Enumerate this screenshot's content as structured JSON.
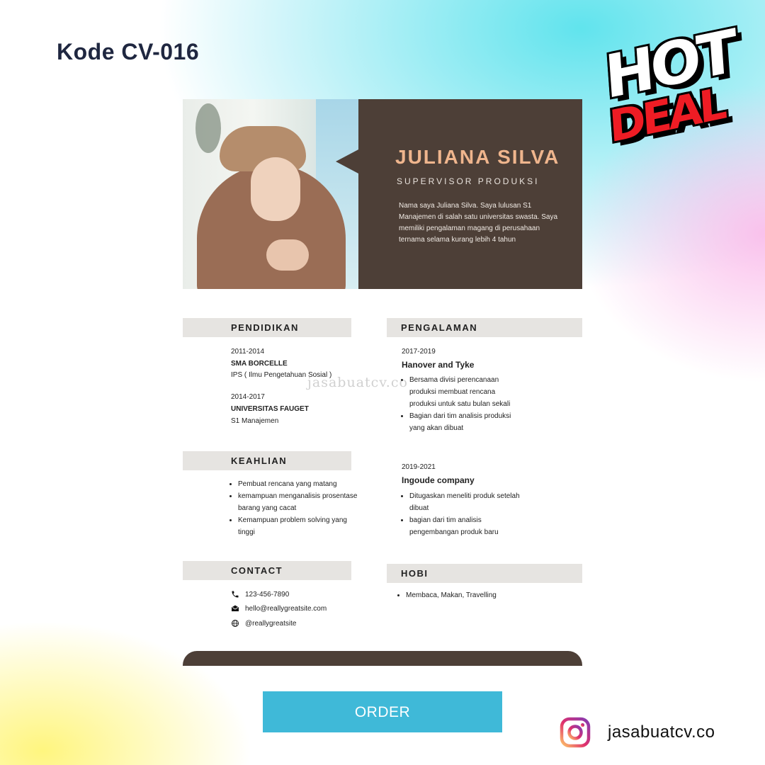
{
  "page": {
    "kode": "Kode CV-016",
    "badge": {
      "line1": "HOT",
      "line2": "DEAL"
    },
    "order_label": "ORDER",
    "instagram_handle": "jasabuatcv.co",
    "watermark": "jasabuatcv.co"
  },
  "cv": {
    "name": "JULIANA SILVA",
    "role": "SUPERVISOR PRODUKSI",
    "about": "Nama saya Juliana Silva. Saya lulusan S1 Manajemen di salah satu universitas swasta. Saya memiliki pengalaman magang di perusahaan ternama selama kurang lebih 4 tahun",
    "pendidikan": {
      "title": "PENDIDIKAN",
      "items": [
        {
          "years": "2011-2014",
          "school": "SMA BORCELLE",
          "detail": "IPS ( Ilmu Pengetahuan Sosial )"
        },
        {
          "years": "2014-2017",
          "school": "UNIVERSITAS FAUGET",
          "detail": "S1 Manajemen"
        }
      ]
    },
    "keahlian": {
      "title": "KEAHLIAN",
      "items": [
        "Pembuat rencana yang matang",
        "kemampuan menganalisis prosentase barang yang cacat",
        "Kemampuan problem solving yang tinggi"
      ]
    },
    "contact": {
      "title": "CONTACT",
      "phone": "123-456-7890",
      "email": "hello@reallygreatsite.com",
      "web": "@reallygreatsite"
    },
    "pengalaman": {
      "title": "PENGALAMAN",
      "items": [
        {
          "years": "2017-2019",
          "company": "Hanover and Tyke",
          "points": [
            "Bersama divisi perencanaan produksi membuat rencana produksi untuk satu bulan sekali",
            "Bagian dari tim analisis produksi yang akan dibuat"
          ]
        },
        {
          "years": "2019-2021",
          "company": "Ingoude company",
          "points": [
            "Ditugaskan meneliti produk setelah dibuat",
            "bagian dari tim analisis pengembangan produk baru"
          ]
        }
      ]
    },
    "hobi": {
      "title": "HOBI",
      "items": [
        "Membaca, Makan, Travelling"
      ]
    }
  },
  "colors": {
    "brown_panel": "#4d3f37",
    "name_accent": "#efb58d",
    "section_bg": "#e6e4e1",
    "order_button": "#3fb9d8",
    "hot_deal_red": "#ee1c24"
  },
  "icons": [
    "phone-icon",
    "mail-icon",
    "globe-icon",
    "instagram-icon"
  ]
}
